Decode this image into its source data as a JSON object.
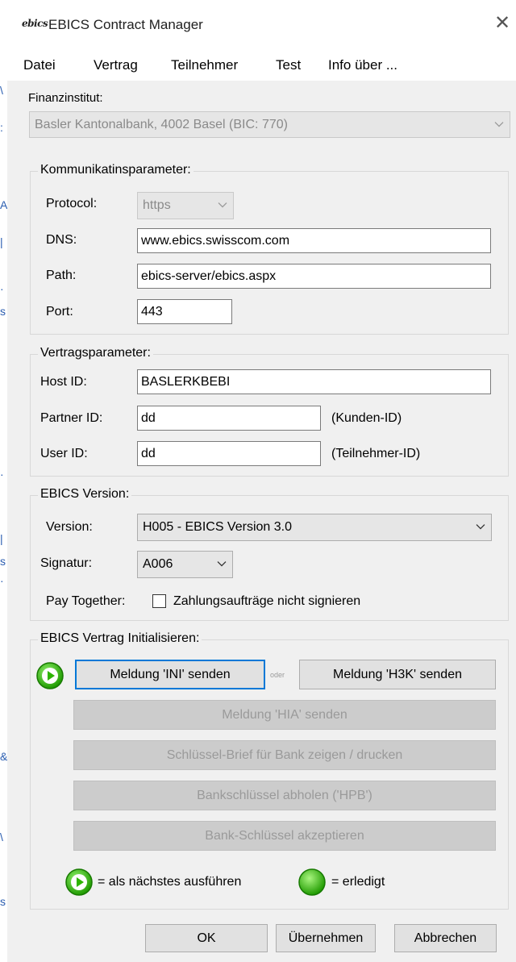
{
  "window": {
    "title": "EBICS Contract Manager",
    "app_icon_text": "ebics",
    "close_glyph": "✕"
  },
  "background_marks": [
    "\\",
    ":",
    "A",
    "|",
    "·",
    "s",
    "·",
    "|",
    "s",
    "·",
    "&",
    "\\",
    "s"
  ],
  "menu": {
    "items": [
      "Datei",
      "Vertrag",
      "Teilnehmer",
      "Test",
      "Info über ..."
    ]
  },
  "finanzinstitut": {
    "label": "Finanzinstitut:",
    "value": "Basler Kantonalbank, 4002 Basel (BIC: 770)"
  },
  "kommunikation": {
    "title": "Kommunikatinsparameter:",
    "protocol_label": "Protocol:",
    "protocol_value": "https",
    "dns_label": "DNS:",
    "dns_value": "www.ebics.swisscom.com",
    "path_label": "Path:",
    "path_value": "ebics-server/ebics.aspx",
    "port_label": "Port:",
    "port_value": "443"
  },
  "vertrag": {
    "title": "Vertragsparameter:",
    "host_label": "Host ID:",
    "host_value": "BASLERKBEBI",
    "partner_label": "Partner ID:",
    "partner_value": "dd",
    "partner_hint": "(Kunden-ID)",
    "user_label": "User ID:",
    "user_value": "dd",
    "user_hint": "(Teilnehmer-ID)"
  },
  "version": {
    "title": "EBICS Version:",
    "version_label": "Version:",
    "version_value": "H005 - EBICS Version 3.0",
    "signatur_label": "Signatur:",
    "signatur_value": "A006",
    "paytogether_label": "Pay Together:",
    "paytogether_checkbox_label": "Zahlungsaufträge nicht signieren",
    "paytogether_checked": false
  },
  "init": {
    "title": "EBICS Vertrag Initialisieren:",
    "ini_button": "Meldung 'INI' senden",
    "oder": "oder",
    "h3k_button": "Meldung 'H3K' senden",
    "hia_button": "Meldung 'HIA' senden",
    "brief_button": "Schlüssel-Brief für Bank zeigen / drucken",
    "hpb_button": "Bankschlüssel abholen ('HPB')",
    "accept_button": "Bank-Schlüssel akzeptieren",
    "legend_next": "= als nächstes ausführen",
    "legend_done": "= erledigt"
  },
  "footer": {
    "ok": "OK",
    "apply": "Übernehmen",
    "cancel": "Abbrechen"
  },
  "colors": {
    "accent": "#0078d7",
    "status_green": "#2db400",
    "window_bg": "#f0f0f0"
  }
}
